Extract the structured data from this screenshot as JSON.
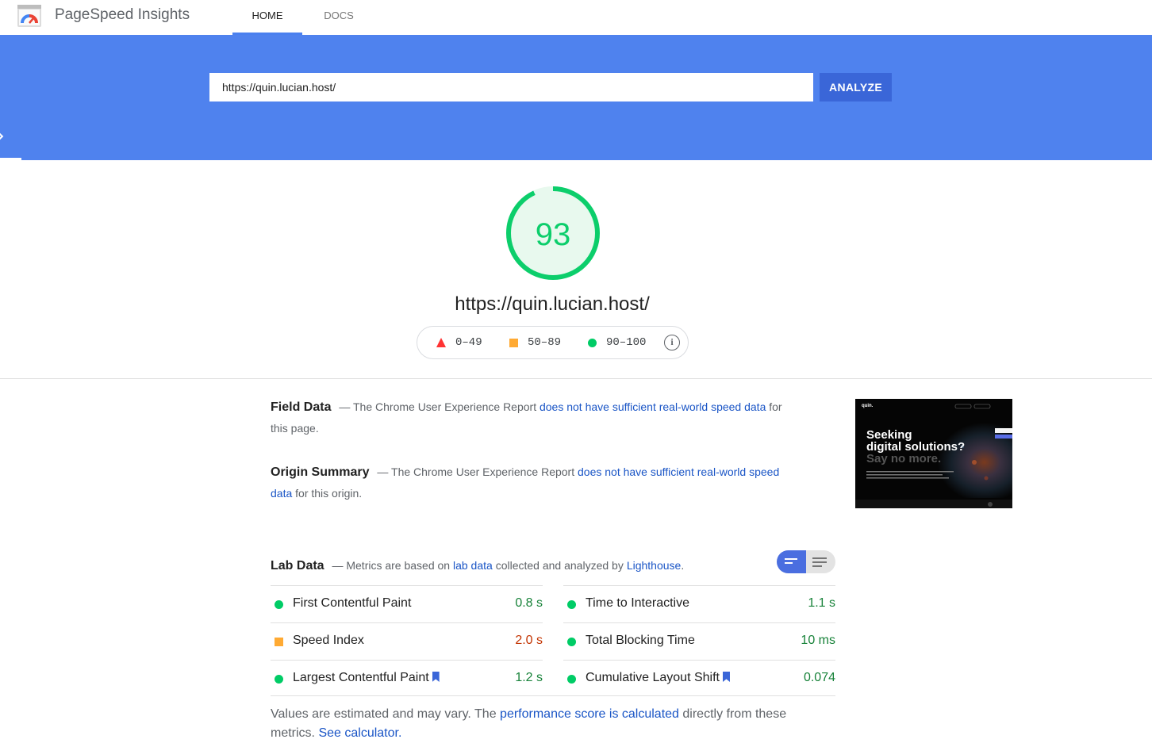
{
  "app": {
    "title": "PageSpeed Insights"
  },
  "nav": {
    "home": "HOME",
    "docs": "DOCS"
  },
  "search": {
    "url_value": "https://quin.lucian.host/",
    "analyze_label": "ANALYZE"
  },
  "score": {
    "value": "93",
    "fraction": 0.93,
    "url": "https://quin.lucian.host/",
    "color": "#0cce6b"
  },
  "legend": {
    "fail": "0–49",
    "average": "50–89",
    "pass": "90–100",
    "info": "i"
  },
  "field_data": {
    "heading": "Field Data",
    "prefix": "— The Chrome User Experience Report",
    "link": "does not have sufficient real-world speed data",
    "suffix": "for this page."
  },
  "origin_summary": {
    "heading": "Origin Summary",
    "prefix": "— The Chrome User Experience Report",
    "link": "does not have sufficient real-world speed data",
    "suffix": "for this origin."
  },
  "screenshot": {
    "brand": "quin.",
    "headline1": "Seeking",
    "headline2": "digital solutions?",
    "headline3": "Say no more."
  },
  "lab_data": {
    "heading": "Lab Data",
    "text1": "— Metrics are based on",
    "link1": "lab data",
    "text2": "collected and analyzed by",
    "link2": "Lighthouse",
    "text3": "."
  },
  "metrics": [
    {
      "label": "First Contentful Paint",
      "value": "0.8 s",
      "status": "green"
    },
    {
      "label": "Time to Interactive",
      "value": "1.1 s",
      "status": "green"
    },
    {
      "label": "Speed Index",
      "value": "2.0 s",
      "status": "orange"
    },
    {
      "label": "Total Blocking Time",
      "value": "10 ms",
      "status": "green"
    },
    {
      "label": "Largest Contentful Paint",
      "value": "1.2 s",
      "status": "green"
    },
    {
      "label": "Cumulative Layout Shift",
      "value": "0.074",
      "status": "green"
    }
  ],
  "footnote": {
    "text1": "Values are estimated and may vary. The",
    "link1": "performance score is calculated",
    "text2": "directly from these metrics.",
    "link2": "See calculator."
  },
  "colors": {
    "header_blue": "#4f82ee",
    "button_blue": "#3a66d8",
    "pass_green": "#0cce6b",
    "average_orange": "#ffaa33",
    "fail_red": "#ff3333"
  }
}
